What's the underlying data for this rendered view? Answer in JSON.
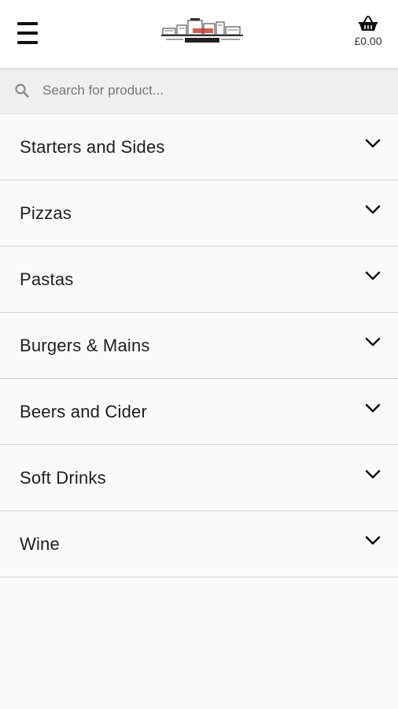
{
  "header": {
    "logo_alt": "restaurant-logo",
    "basket_total": "£0.00"
  },
  "search": {
    "placeholder": "Search for product..."
  },
  "categories": [
    {
      "label": "Starters and Sides"
    },
    {
      "label": "Pizzas"
    },
    {
      "label": "Pastas"
    },
    {
      "label": "Burgers & Mains"
    },
    {
      "label": "Beers and Cider"
    },
    {
      "label": "Soft Drinks"
    },
    {
      "label": "Wine"
    }
  ],
  "colors": {
    "header_bg": "#ffffff",
    "page_bg": "#fafafa",
    "search_bg": "#efefef",
    "divider": "#cfcfcf",
    "text": "#1e1e1e"
  },
  "icons": {
    "menu": "hamburger-menu-icon",
    "basket": "basket-icon",
    "search": "search-icon",
    "expand": "chevron-down-icon"
  }
}
